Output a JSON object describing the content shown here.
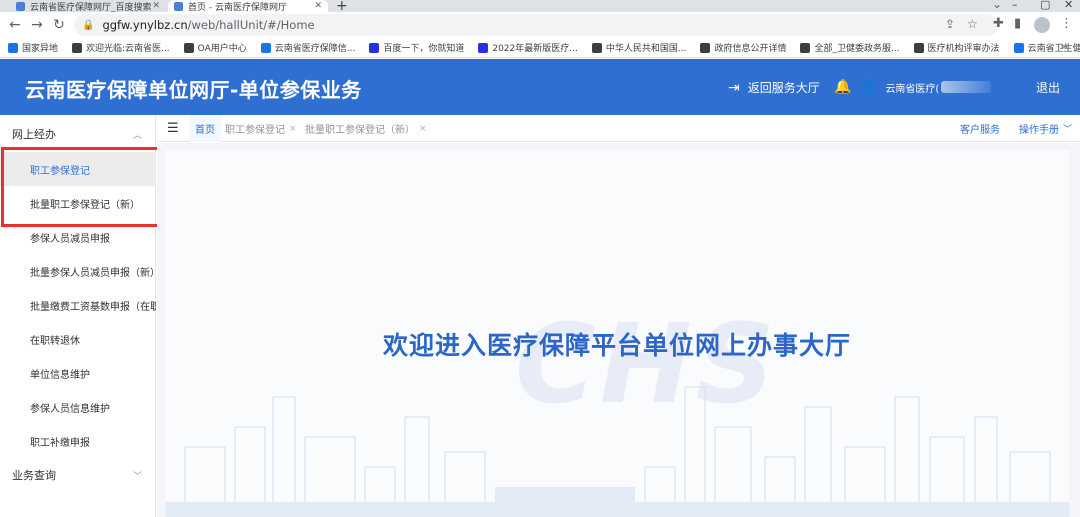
{
  "browser": {
    "tabs": [
      {
        "title": "云南省医疗保障网厅_百度搜索"
      },
      {
        "title": "首页 - 云南医疗保障网厅"
      }
    ],
    "new_tab": "+",
    "url_host": "ggfw.ynylbz.cn",
    "url_path": "/web/hallUnit/#/Home"
  },
  "bookmarks": [
    {
      "label": "国家异地",
      "color": "#1a73e8"
    },
    {
      "label": "欢迎光临:云南省医...",
      "color": "#3c4043"
    },
    {
      "label": "OA用户中心",
      "color": "#3c4043"
    },
    {
      "label": "云南省医疗保障信...",
      "color": "#1a73e8"
    },
    {
      "label": "百度一下，你就知道",
      "color": "#2932e1"
    },
    {
      "label": "2022年最新版医疗...",
      "color": "#2932e1"
    },
    {
      "label": "中华人民共和国国...",
      "color": "#3c4043"
    },
    {
      "label": "政府信息公开详情",
      "color": "#3c4043"
    },
    {
      "label": "全部_卫健委政务服...",
      "color": "#3c4043"
    },
    {
      "label": "医疗机构评审办法",
      "color": "#3c4043"
    },
    {
      "label": "云南省卫生健康委...",
      "color": "#1a73e8"
    }
  ],
  "header": {
    "title": "云南医疗保障单位网厅-单位参保业务",
    "back_label": "返回服务大厅",
    "user_label": "云南省医疗(",
    "logout_label": "退出"
  },
  "sidebar": {
    "group1": "网上经办",
    "items": [
      {
        "label": "职工参保登记"
      },
      {
        "label": "批量职工参保登记（新）"
      },
      {
        "label": "参保人员减员申报"
      },
      {
        "label": "批量参保人员减员申报（新）"
      },
      {
        "label": "批量缴费工资基数申报（在职"
      },
      {
        "label": "在职转退休"
      },
      {
        "label": "单位信息维护"
      },
      {
        "label": "参保人员信息维护"
      },
      {
        "label": "职工补缴申报"
      }
    ],
    "group2": "业务查询"
  },
  "page_tabs": [
    {
      "label": "首页"
    },
    {
      "label": "职工参保登记"
    },
    {
      "label": "批量职工参保登记（新）"
    }
  ],
  "tab_links": {
    "customer_service": "客户服务",
    "manual": "操作手册"
  },
  "main": {
    "logo_text": "CHS",
    "welcome": "欢迎进入医疗保障平台单位网上办事大厅"
  },
  "colors": {
    "brand_blue": "#2e6fd1",
    "highlight_red": "#e8312f"
  }
}
